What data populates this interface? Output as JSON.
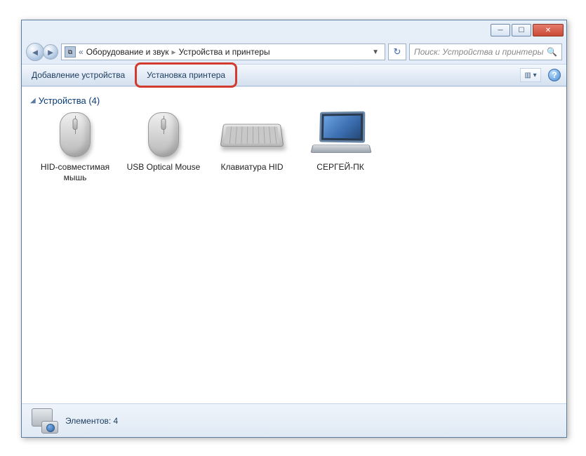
{
  "breadcrumb": {
    "prefix": "«",
    "part1": "Оборудование и звук",
    "part2": "Устройства и принтеры"
  },
  "search": {
    "placeholder": "Поиск: Устройства и принтеры"
  },
  "toolbar": {
    "add_device": "Добавление устройства",
    "add_printer": "Установка принтера"
  },
  "group": {
    "title": "Устройства (4)"
  },
  "items": [
    {
      "label": "HID-совместимая мышь",
      "iconType": "mouse"
    },
    {
      "label": "USB Optical Mouse",
      "iconType": "mouse"
    },
    {
      "label": "Клавиатура HID",
      "iconType": "keyboard"
    },
    {
      "label": "СЕРГЕЙ-ПК",
      "iconType": "laptop"
    }
  ],
  "status": {
    "count_label": "Элементов: 4"
  },
  "icons": {
    "back": "◄",
    "forward": "►",
    "refresh": "↻",
    "search": "🔍",
    "dropdown": "▼",
    "separator": "▸",
    "expand": "◢",
    "help": "?",
    "view": "▥ ▾"
  }
}
